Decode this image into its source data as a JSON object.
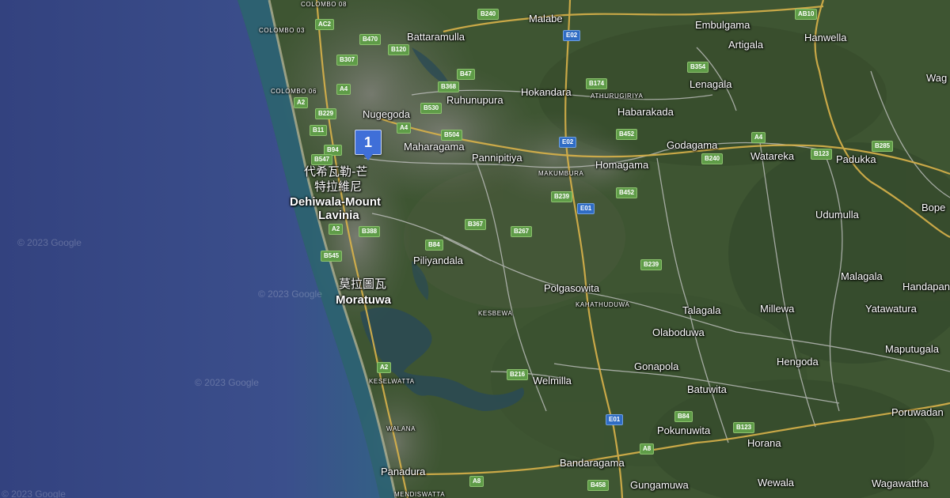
{
  "map": {
    "type": "satellite-hybrid",
    "colors": {
      "ocean": "#3a4d8a",
      "coast_water": "#2d5f7a",
      "land": "#3e5532",
      "urban": "#6d7166",
      "road_major": "#d9b24a",
      "road_minor": "#c9c9c9",
      "shield": "#5f9c48",
      "expressway_shield": "#2f6cc4",
      "marker": "#3f6fd8"
    },
    "marker": {
      "number": "1",
      "icon": "numbered-pin-icon"
    },
    "labels": {
      "colombo_08": "COLOMBO 08",
      "colombo_03": "COLOMBO 03",
      "colombo_06": "COLOMBO 06",
      "battaramulla": "Battaramulla",
      "malabe": "Malabe",
      "embulgama": "Embulgama",
      "artigala": "Artigala",
      "hanwella": "Hanwella",
      "wag": "Wag",
      "nugegoda": "Nugegoda",
      "ruhunupura": "Ruhunupura",
      "hokandara": "Hokandara",
      "athurugiriya": "ATHURUGIRIYA",
      "habarakada": "Habarakada",
      "lenagala": "Lenagala",
      "maharagama": "Maharagama",
      "pannipitiya": "Pannipitiya",
      "makumbura": "MAKUMBURA",
      "homagama": "Homagama",
      "godagama": "Godagama",
      "watareka": "Watareka",
      "padukka": "Padukka",
      "dehiwala_cjk_1": "代希瓦勒-芒",
      "dehiwala_cjk_2": "特拉維尼",
      "dehiwala_1": "Dehiwala-Mount",
      "dehiwala_2": "Lavinia",
      "udumulla": "Udumulla",
      "bope": "Bope",
      "piliyandala": "Piliyandala",
      "malagala": "Malagala",
      "handapan": "Handapan",
      "moratuwa_cjk": "莫拉圖瓦",
      "moratuwa": "Moratuwa",
      "polgasowita": "Polgasowita",
      "kahathuduwa": "KAHATHUDUWA",
      "talagala": "Talagala",
      "millewa": "Millewa",
      "yatawatura": "Yatawatura",
      "kesbewa": "KESBEWA",
      "olaboduwa": "Olaboduwa",
      "maputugala": "Maputugala",
      "hengoda": "Hengoda",
      "gonapola": "Gonapola",
      "keselwatta": "KESELWATTA",
      "welmilla": "Welmilla",
      "batuwita": "Batuwita",
      "poruwadan": "Poruwadan",
      "walana": "WALANA",
      "pokunuwita": "Pokunuwita",
      "horana": "Horana",
      "panadura": "Panadura",
      "bandaragama": "Bandaragama",
      "wewala": "Wewala",
      "wagawattha": "Wagawattha",
      "gungamuwa": "Gungamuwa",
      "mendiswatta": "MENDISWATTA"
    },
    "shields": {
      "b240a": "B240",
      "ac2": "AC2",
      "b470": "B470",
      "b120": "B120",
      "e02a": "E02",
      "ab10": "AB10",
      "b307": "B307",
      "a4a": "A4",
      "a2a": "A2",
      "b47": "B47",
      "b368": "B368",
      "b174": "B174",
      "b354": "B354",
      "b229": "B229",
      "b530": "B530",
      "a4b": "A4",
      "b11": "B11",
      "b504": "B504",
      "e02b": "E02",
      "b452a": "B452",
      "a4c": "A4",
      "b94": "B94",
      "b547": "B547",
      "b240b": "B240",
      "b123a": "B123",
      "b285": "B285",
      "b239a": "B239",
      "b452b": "B452",
      "e01a": "E01",
      "b367": "B367",
      "a2b": "A2",
      "b388": "B388",
      "b84a": "B84",
      "b267": "B267",
      "b545": "B545",
      "b239b": "B239",
      "b216": "B216",
      "a2c": "A2",
      "e01b": "E01",
      "b84b": "B84",
      "b123b": "B123",
      "a8a": "A8",
      "a8b": "A8",
      "b458": "B458"
    },
    "watermarks": {
      "w1": "© 2023 Google",
      "w2": "© 2023 Google",
      "w3": "© 2023 Google",
      "w4": "© 2023 Google"
    }
  }
}
